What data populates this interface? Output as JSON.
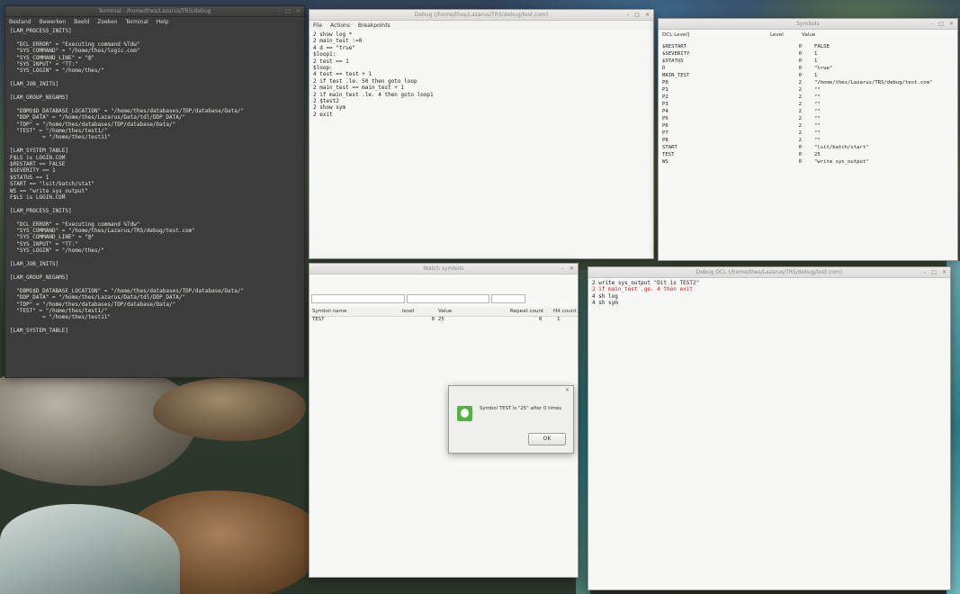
{
  "terminal": {
    "title": "Terminal - /home/thes/Lazarus/TRS/debug",
    "menu": [
      "Bestand",
      "Bewerken",
      "Beeld",
      "Zoeken",
      "Terminal",
      "Help"
    ],
    "lines": [
      "[LAM_PROCESS_INITS]",
      "",
      "  \"DCL_ERROR\" = \"Executing command %Tdw\"",
      "  \"SYS_COMMAND\" = \"/home/thes/logic.com\"",
      "  \"SYS_COMMAND_LINE\" = \"@\"",
      "  \"SYS_INPUT\" = \"TT:\"",
      "  \"SYS_LOGIN\" = \"/home/thes/\"",
      "",
      "[LAM_JOB_INITS]",
      "",
      "[LAM_GROUP_NEGAMS]",
      "",
      "  \"DBMS$D_DATABASE_LOCATION\" = \"/home/thes/databases/TDP/database/Data/\"",
      "  \"DDP_DATA\" = \"/home/thes/Lazarus/Data/tdl/DDP_DATA/\"",
      "  \"TDP\" = \"/home/thes/databases/TDP/database/Data/\"",
      "  \"TEST\" = \"/home/thes/test1/\"",
      "          = \"/home/thes/test11\"",
      "",
      "[LAM_SYSTEM_TABLE]",
      "F$LS is LOGIN.COM",
      "$RESTART == FALSE",
      "$SEVERITY == 1",
      "$STATUS == 1",
      "START == \"lsit/batch/stat\"",
      "WS == \"write sys_output\"",
      "F$LS is LOGIN.COM",
      "",
      "[LAM_PROCESS_INITS]",
      "",
      "  \"DCL_ERROR\" = \"Executing command %Tdw\"",
      "  \"SYS_COMMAND\" = \"/home/thes/Lazarus/TRS/debug/test.com\"",
      "  \"SYS_COMMAND_LINE\" = \"@\"",
      "  \"SYS_INPUT\" = \"TT:\"",
      "  \"SYS_LOGIN\" = \"/home/thes/\"",
      "",
      "[LAM_JOB_INITS]",
      "",
      "[LAM_GROUP_NEGAMS]",
      "",
      "  \"DBMS$D_DATABASE_LOCATION\" = \"/home/thes/databases/TDP/database/Data/\"",
      "  \"DDP_DATA\" = \"/home/thes/Lazarus/Data/tdl/DDP_DATA/\"",
      "  \"TDP\" = \"/home/thes/databases/TDP/database/Data/\"",
      "  \"TEST\" = \"/home/thes/test1/\"",
      "          = \"/home/thes/test11\"",
      "",
      "[LAM_SYSTEM_TABLE]"
    ]
  },
  "editor": {
    "title": "Debug (/home/thes/Lazarus/TRS/debug/test.com)",
    "menu": [
      "File",
      "Actions",
      "Breakpoints"
    ],
    "lines": [
      "2 show log *",
      "2 main_test :=0",
      "4 d == \"true\"",
      "$loop1:",
      "2 test == 1",
      "$loop:",
      "4 test == test + 1",
      "2 if test .le. 50 then goto loop",
      "2 main_test == main_test + 1",
      "2 if main_test .le. 4 then goto loop1",
      "2 $test2",
      "2 show sym",
      "2 exit"
    ]
  },
  "symbols": {
    "title": "Symbols",
    "headers": [
      "DCL Level]",
      "Level",
      "Value"
    ],
    "rows": [
      [
        "$RESTART",
        "0",
        "FALSE"
      ],
      [
        "$SEVERITY",
        "0",
        "1"
      ],
      [
        "$STATUS",
        "0",
        "1"
      ],
      [
        "D",
        "0",
        "\"true\""
      ],
      [
        "MAIN_TEST",
        "0",
        "1"
      ],
      [
        "P0",
        "2",
        "\"/home/thes/Lazarus/TRS/debug/test.com\""
      ],
      [
        "P1",
        "2",
        "\"\""
      ],
      [
        "P2",
        "2",
        "\"\""
      ],
      [
        "P3",
        "2",
        "\"\""
      ],
      [
        "P4",
        "2",
        "\"\""
      ],
      [
        "P5",
        "2",
        "\"\""
      ],
      [
        "P6",
        "2",
        "\"\""
      ],
      [
        "P7",
        "2",
        "\"\""
      ],
      [
        "P8",
        "2",
        "\"\""
      ],
      [
        "START",
        "0",
        "\"lsit/batch/start\""
      ],
      [
        "TEST",
        "0",
        "25"
      ],
      [
        "WS",
        "0",
        "\"write sys_output\""
      ]
    ]
  },
  "watch": {
    "title": "Watch symbols",
    "headers": [
      "Symbol name",
      "level",
      "Value",
      "Repeat count",
      "Hit count"
    ],
    "row": [
      "TEST",
      "0",
      "25",
      "0",
      "1"
    ]
  },
  "output": {
    "title": "Debug DCL (/home/thes/Lazarus/TRS/debug/test.com)",
    "lines": [
      {
        "text": "2 write sys_output \"Dit is TEST2\"",
        "err": false
      },
      {
        "text": "2 if main_test .ge. 4 then exit",
        "err": true
      },
      {
        "text": "4 sh log",
        "err": false
      },
      {
        "text": "4 sh sym",
        "err": false
      }
    ]
  },
  "dialog": {
    "message": "Symbol TEST is \"25\" after 0 times",
    "ok_label": "OK"
  }
}
